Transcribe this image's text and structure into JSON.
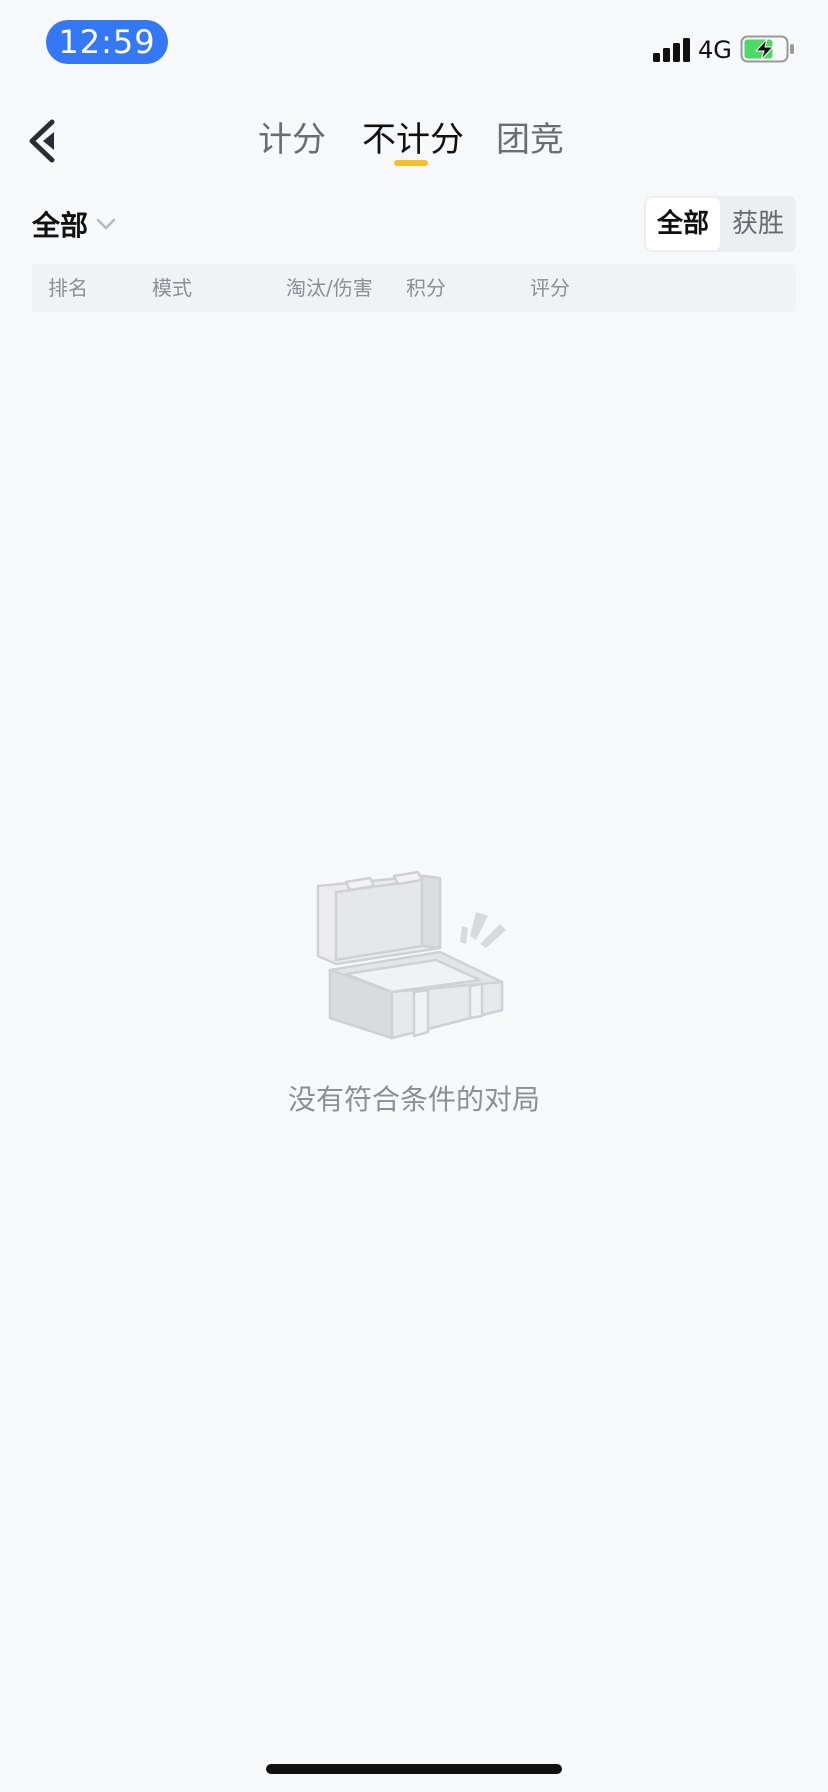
{
  "status_bar": {
    "time": "12:59",
    "network": "4G",
    "icons": [
      "signal-icon",
      "battery-charging-icon"
    ],
    "battery_level": 0.7,
    "battery_color": "#4cd964"
  },
  "nav": {
    "back_icon": "back-arrow-icon",
    "tabs": [
      {
        "label": "计分",
        "active": false
      },
      {
        "label": "不计分",
        "active": true
      },
      {
        "label": "团竞",
        "active": false
      }
    ],
    "indicator_color": "#f5c02d"
  },
  "filter": {
    "dropdown_label": "全部",
    "dropdown_icon": "chevron-down-icon",
    "segments": [
      {
        "label": "全部",
        "selected": true
      },
      {
        "label": "获胜",
        "selected": false
      }
    ]
  },
  "table": {
    "headers": [
      "排名",
      "模式",
      "淘汰/伤害",
      "积分",
      "评分"
    ]
  },
  "empty_state": {
    "icon": "empty-chest-icon",
    "message": "没有符合条件的对局"
  },
  "accent_colors": {
    "time_pill": "#3478f6",
    "background": "#f7f8fa"
  }
}
